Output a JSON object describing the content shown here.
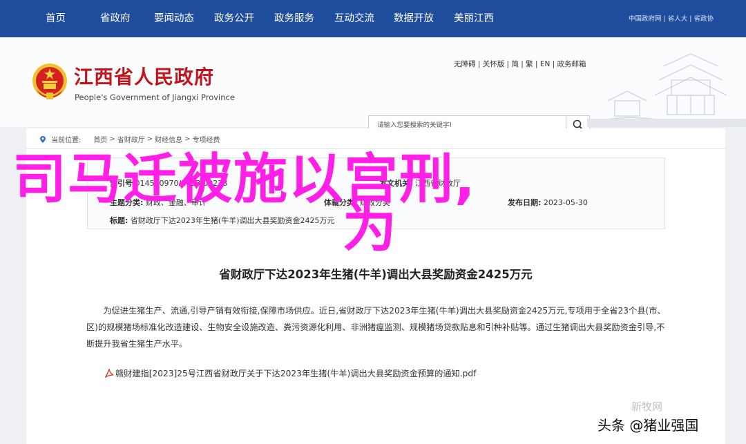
{
  "nav": {
    "items": [
      "首页",
      "省政府",
      "要闻动态",
      "政务公开",
      "政务服务",
      "互动交流",
      "数据开放",
      "美丽江西"
    ],
    "utility": "中国政府网 | 省人大 | 省政协"
  },
  "header": {
    "title": "江西省人民政府",
    "subtitle": "People's Government of Jiangxi Province",
    "tools": "无障碍 | 关怀版 | 简 | 繁 | EN | 政务邮箱",
    "search_placeholder": "请输入您要搜索的关键字!"
  },
  "breadcrumb": {
    "label": "当前位置:",
    "items": [
      "首页",
      "省财政厅",
      "财经信息",
      "专项经费"
    ],
    "separator": ">"
  },
  "info": {
    "index_label": "索引号",
    "index_value": "014500970/2023-00238",
    "publisher_label": "发文机关:",
    "publisher_value": "江西省财政厅",
    "topic_label": "主题分类:",
    "topic_value": "财政、金融、审计",
    "category_label": "体裁分类:",
    "category_value": "财政分类",
    "date_label": "发布日期:",
    "date_value": "2023-05-30",
    "title_label": "标题:",
    "title_value": "省财政厅下达2023年生猪(牛羊)调出大县奖励资金2425万元"
  },
  "article": {
    "title": "省财政厅下达2023年生猪(牛羊)调出大县奖励资金2425万元",
    "body": "为促进生猪生产、流通,引导产销有效衔接,保障市场供应。近日,省财政厅下达2023年生猪(牛羊)调出大县奖励资金2425万元,专项用于全省23个县(市、区)的规模猪场标准化改造建设、生物安全设施改造、粪污资源化利用、非洲猪瘟监测、规模猪场贷款贴息和引种补贴等。通过生猪调出大县奖励资金引导,不断提升我省生猪生产水平。",
    "attachment": "赣财建指[2023]25号江西省财政厅关于下达2023年生猪(牛羊)调出大县奖励资金预算的通知.pdf"
  },
  "overlay": {
    "line1": "司马迁被施以宫刑,",
    "line2": "为"
  },
  "watermark": {
    "small": "新牧网",
    "main": "头条 @猪业强国"
  },
  "colors": {
    "nav_bg": "#1f4d9d",
    "brand_red": "#c3141b",
    "overlay": "#ff1fe6"
  }
}
